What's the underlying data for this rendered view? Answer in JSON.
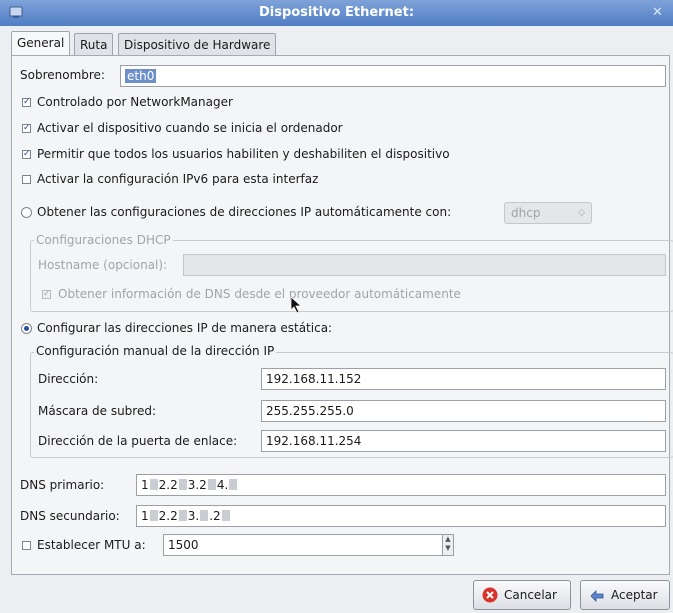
{
  "window": {
    "title": "Dispositivo Ethernet:"
  },
  "tabs": [
    {
      "label": "General",
      "active": true
    },
    {
      "label": "Ruta",
      "active": false
    },
    {
      "label": "Dispositivo de Hardware",
      "active": false
    }
  ],
  "general": {
    "nickname_label": "Sobrenombre:",
    "nickname_value": "eth0",
    "checks": [
      {
        "label": "Controlado por NetworkManager",
        "checked": true
      },
      {
        "label": "Activar el dispositivo cuando se inicia el ordenador",
        "checked": true
      },
      {
        "label": "Permitir que todos los usuarios habiliten y deshabiliten el dispositivo",
        "checked": true
      },
      {
        "label": "Activar la configuración IPv6 para esta interfaz",
        "checked": false
      }
    ],
    "auto_radio_label": "Obtener las configuraciones de direcciones IP automáticamente con:",
    "auto_method": "dhcp",
    "dhcp_frame_title": "Configuraciones DHCP",
    "hostname_label": "Hostname (opcional):",
    "hostname_value": "",
    "dns_from_provider_label": "Obtener información de DNS desde el proveedor automáticamente",
    "static_radio_label": "Configurar las direcciones IP de manera estática:",
    "static_frame_title": "Configuración manual de la dirección IP",
    "address_label": "Dirección:",
    "address_value": "192.168.11.152",
    "netmask_label": "Máscara de subred:",
    "netmask_value": "255.255.255.0",
    "gateway_label": "Dirección de la puerta de enlace:",
    "gateway_value": "192.168.11.254",
    "dns1_label": "DNS primario:",
    "dns1_parts": [
      "1",
      "2.2",
      "3.2",
      "4."
    ],
    "dns2_label": "DNS secundario:",
    "dns2_parts": [
      "1",
      "2.2",
      "3.",
      ".2"
    ],
    "mtu_label": "Establecer MTU a:",
    "mtu_value": "1500"
  },
  "buttons": {
    "cancel": "Cancelar",
    "ok": "Aceptar"
  },
  "colors": {
    "titlebar": "#4f7dc4",
    "accent": "#2b4f9c",
    "cancel_icon": "#d9312b"
  }
}
